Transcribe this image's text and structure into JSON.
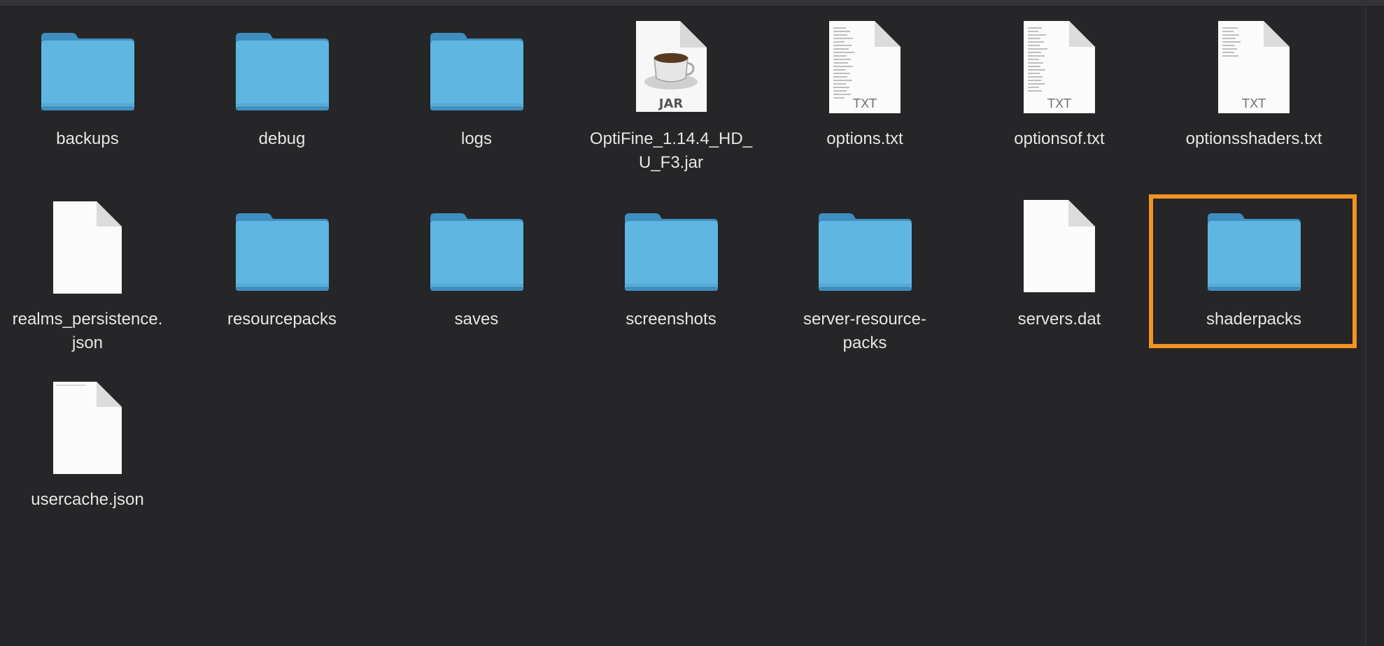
{
  "window": {
    "accent_color": "#f39323",
    "folder_color": "#5fb6e0",
    "background_color": "#262527"
  },
  "files": [
    {
      "name": "backups",
      "kind": "folder",
      "icon": "folder-icon"
    },
    {
      "name": "debug",
      "kind": "folder",
      "icon": "folder-icon"
    },
    {
      "name": "logs",
      "kind": "folder",
      "icon": "folder-icon"
    },
    {
      "name": "OptiFine_1.14.4_HD_\nU_F3.jar",
      "kind": "jar",
      "icon": "jar-file-icon",
      "badge": "JAR"
    },
    {
      "name": "options.txt",
      "kind": "txt",
      "icon": "text-file-icon",
      "badge": "TXT"
    },
    {
      "name": "optionsof.txt",
      "kind": "txt",
      "icon": "text-file-icon",
      "badge": "TXT"
    },
    {
      "name": "optionsshaders.txt",
      "kind": "txt",
      "icon": "text-file-icon",
      "badge": "TXT"
    },
    {
      "name": "realms_persistence.\njson",
      "kind": "doc",
      "icon": "document-icon"
    },
    {
      "name": "resourcepacks",
      "kind": "folder",
      "icon": "folder-icon"
    },
    {
      "name": "saves",
      "kind": "folder",
      "icon": "folder-icon"
    },
    {
      "name": "screenshots",
      "kind": "folder",
      "icon": "folder-icon"
    },
    {
      "name": "server-resource-\npacks",
      "kind": "folder",
      "icon": "folder-icon"
    },
    {
      "name": "servers.dat",
      "kind": "doc",
      "icon": "document-icon"
    },
    {
      "name": "shaderpacks",
      "kind": "folder",
      "icon": "folder-icon",
      "selected": true
    },
    {
      "name": "usercache.json",
      "kind": "doc",
      "icon": "document-icon"
    }
  ]
}
